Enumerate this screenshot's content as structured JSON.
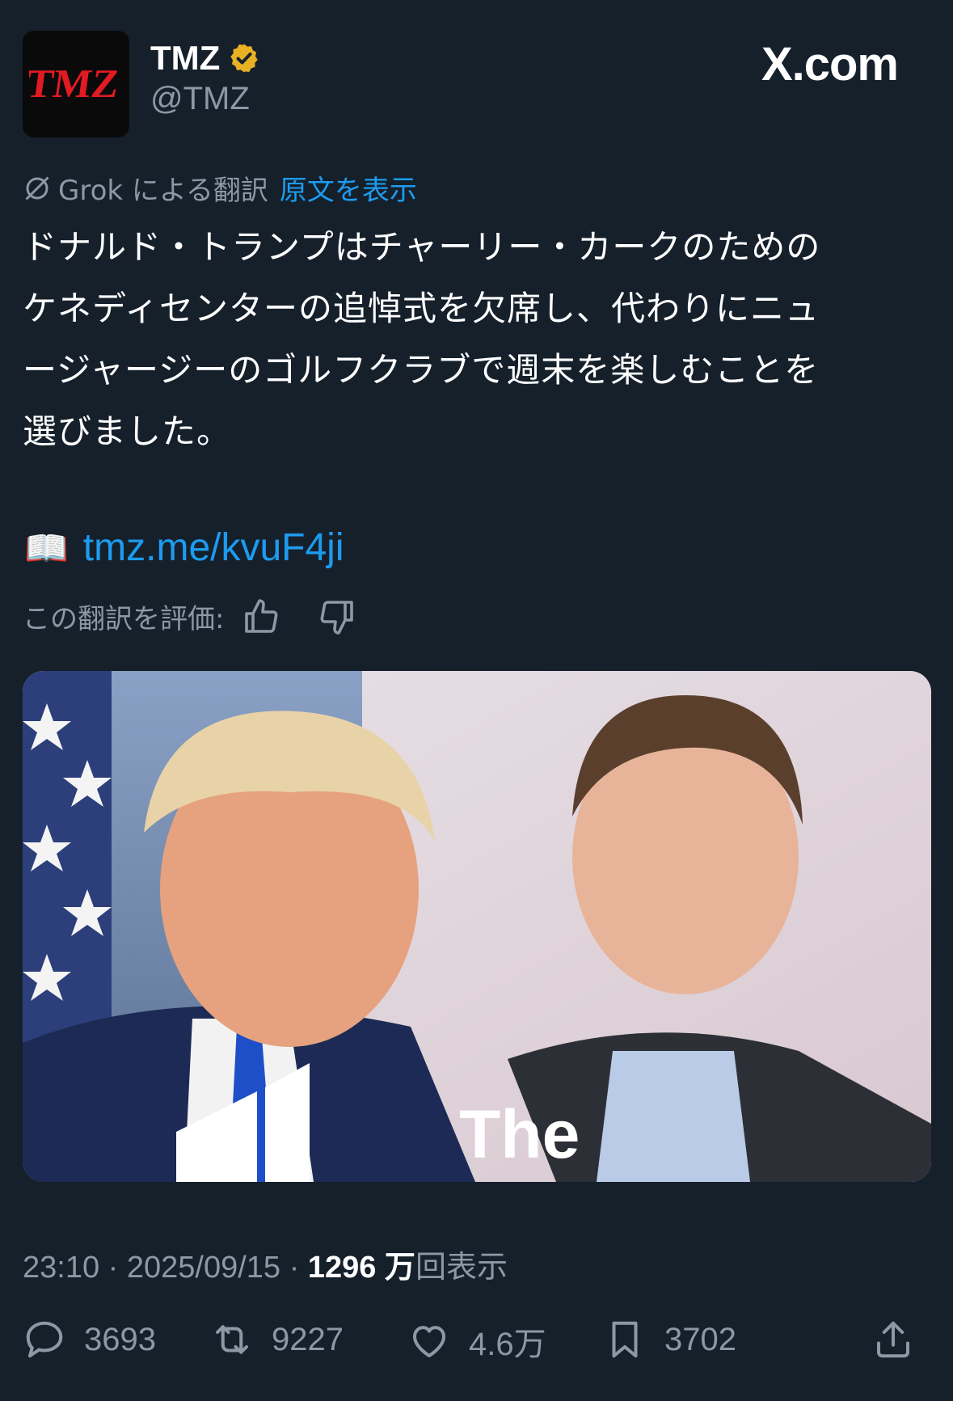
{
  "header": {
    "avatar_text": "TMZ",
    "name": "TMZ",
    "handle": "@TMZ",
    "site": "X.com",
    "verified_color": "#e8b024"
  },
  "translation": {
    "provider_label": "Grok による翻訳",
    "show_original": "原文を表示"
  },
  "tweet": {
    "lines": [
      " ドナルド・トランプはチャーリー・カークのための",
      "ケネディセンターの追悼式を欠席し、代わりにニュ",
      "ージャージーのゴルフクラブで週末を楽しむことを",
      "選びました。"
    ],
    "link_emoji": "📖",
    "link": "tmz.me/kvuF4ji"
  },
  "rate": {
    "label": "この翻訳を評価:"
  },
  "media": {
    "overlay_text": "The"
  },
  "meta": {
    "time": "23:10",
    "date": "2025/09/15",
    "views_count": "1296 万",
    "views_label": "回表示"
  },
  "actions": {
    "replies": "3693",
    "reposts": "9227",
    "likes": "4.6万",
    "bookmarks": "3702"
  },
  "colors": {
    "background": "#15202b",
    "accent": "#1d9bf0",
    "muted": "#8b98a5",
    "tmz_red": "#e21a22"
  }
}
